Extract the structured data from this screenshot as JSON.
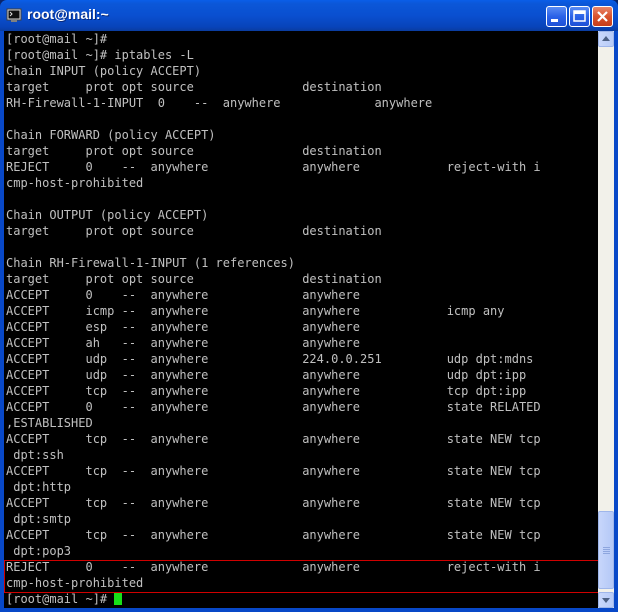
{
  "window": {
    "title": "root@mail:~",
    "icons": {
      "app": "terminal-icon",
      "minimize": "minimize-icon",
      "maximize": "maximize-icon",
      "close": "close-icon"
    }
  },
  "terminal": {
    "lines": [
      "[root@mail ~]#",
      "[root@mail ~]# iptables -L",
      "Chain INPUT (policy ACCEPT)",
      "target     prot opt source               destination",
      "RH-Firewall-1-INPUT  0    --  anywhere             anywhere",
      "",
      "Chain FORWARD (policy ACCEPT)",
      "target     prot opt source               destination",
      "REJECT     0    --  anywhere             anywhere            reject-with i",
      "cmp-host-prohibited",
      "",
      "Chain OUTPUT (policy ACCEPT)",
      "target     prot opt source               destination",
      "",
      "Chain RH-Firewall-1-INPUT (1 references)",
      "target     prot opt source               destination",
      "ACCEPT     0    --  anywhere             anywhere",
      "ACCEPT     icmp --  anywhere             anywhere            icmp any",
      "ACCEPT     esp  --  anywhere             anywhere",
      "ACCEPT     ah   --  anywhere             anywhere",
      "ACCEPT     udp  --  anywhere             224.0.0.251         udp dpt:mdns",
      "ACCEPT     udp  --  anywhere             anywhere            udp dpt:ipp",
      "ACCEPT     tcp  --  anywhere             anywhere            tcp dpt:ipp",
      "ACCEPT     0    --  anywhere             anywhere            state RELATED",
      ",ESTABLISHED",
      "ACCEPT     tcp  --  anywhere             anywhere            state NEW tcp",
      " dpt:ssh",
      "ACCEPT     tcp  --  anywhere             anywhere            state NEW tcp",
      " dpt:http",
      "ACCEPT     tcp  --  anywhere             anywhere            state NEW tcp",
      " dpt:smtp",
      "ACCEPT     tcp  --  anywhere             anywhere            state NEW tcp",
      " dpt:pop3",
      "REJECT     0    --  anywhere             anywhere            reject-with i",
      "cmp-host-prohibited"
    ],
    "prompt": "[root@mail ~]# ",
    "colors": {
      "text": "#c0c0c0",
      "background": "#000000",
      "cursor": "#18e018",
      "highlight_border": "#d00000"
    }
  }
}
